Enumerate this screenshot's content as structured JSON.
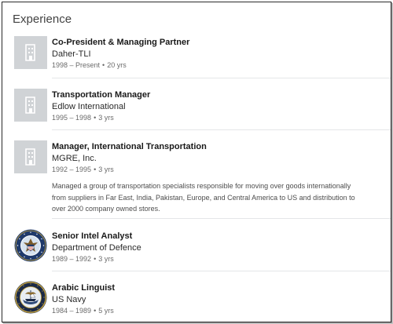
{
  "section": {
    "title": "Experience"
  },
  "experience": [
    {
      "title": "Co-President & Managing Partner",
      "company": "Daher-TLI",
      "date_range": "1998 – Present",
      "duration": "20 yrs",
      "logo": "building-placeholder-icon"
    },
    {
      "title": "Transportation Manager",
      "company": "Edlow International",
      "date_range": "1995 – 1998",
      "duration": "3 yrs",
      "logo": "building-placeholder-icon"
    },
    {
      "title": "Manager, International Transportation",
      "company": "MGRE, Inc.",
      "date_range": "1992 – 1995",
      "duration": "3 yrs",
      "logo": "building-placeholder-icon",
      "description": "Managed a group of transportation specialists responsible for moving over goods internationally from suppliers in Far East, India, Pakistan, Europe, and Central America to US and distribution to over 2000 company owned stores."
    },
    {
      "title": "Senior Intel Analyst",
      "company": "Department of Defence",
      "date_range": "1989 – 1992",
      "duration": "3 yrs",
      "logo": "department-of-defense-seal-icon"
    },
    {
      "title": "Arabic Linguist",
      "company": "US Navy",
      "date_range": "1984 – 1989",
      "duration": "5 yrs",
      "logo": "us-navy-seal-icon"
    }
  ],
  "colors": {
    "placeholder_bg": "#d0d3d6",
    "placeholder_icon": "#ffffff",
    "divider": "#e4e6e8",
    "dod_blue": "#1f3a6b",
    "navy_blue": "#1b2a48",
    "navy_gold": "#c9a640"
  }
}
